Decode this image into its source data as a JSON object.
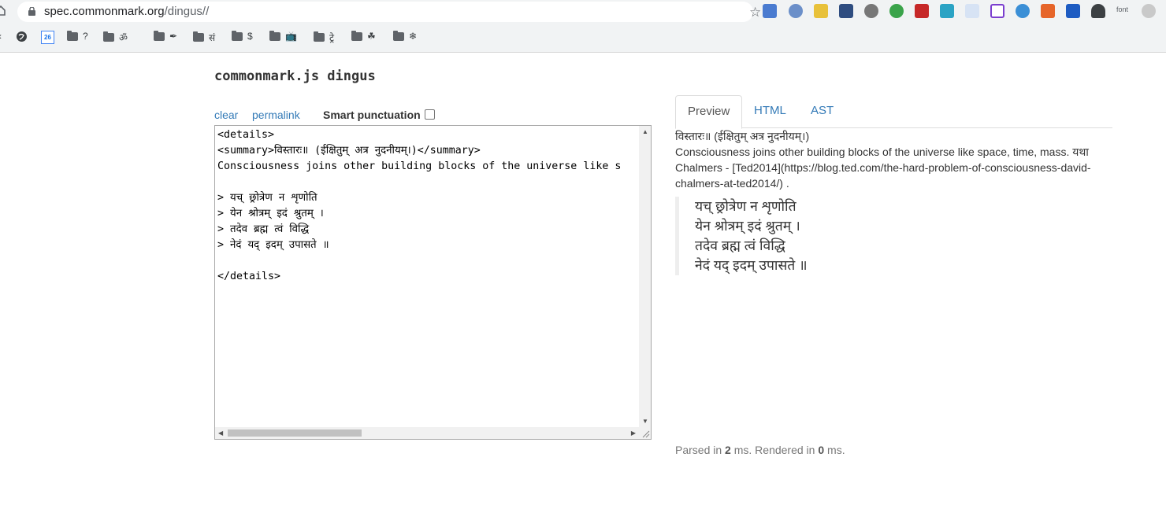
{
  "browser": {
    "url_host": "spec.commonmark.org",
    "url_path": "/dingus//",
    "extensions_font_label": "font",
    "bookmarks": [
      "?",
      "ॐ",
      "✒",
      "सं",
      "$",
      "📺",
      "ट्रे",
      "☘",
      "❄"
    ],
    "calendar_label": "26"
  },
  "page": {
    "title": "commonmark.js dingus",
    "clear_label": "clear",
    "permalink_label": "permalink",
    "smart_label": "Smart punctuation"
  },
  "editor": {
    "text": "<details>\n<summary>विस्तारः॥ (ईक्षितुम् अत्र नुदनीयम्।)</summary>\nConsciousness joins other building blocks of the universe like s\n\n> यच् छ्रोत्रेण न शृणोति\n> येन श्रोत्रम् इदं श्रुतम् ।\n> तदेव ब्रह्म त्वं विद्धि\n> नेदं यद् इदम् उपासते ॥\n\n</details>"
  },
  "tabs": {
    "preview": "Preview",
    "html": "HTML",
    "ast": "AST"
  },
  "preview": {
    "summary": "विस्तारः॥ (ईक्षितुम् अत्र नुदनीयम्।)",
    "paragraph": "Consciousness joins other building blocks of the universe like space, time, mass. यथा Chalmers - [Ted2014](https://blog.ted.com/the-hard-problem-of-consciousness-david-chalmers-at-ted2014/) .",
    "quote_lines": [
      "यच् छ्रोत्रेण न शृणोति",
      "येन श्रोत्रम् इदं श्रुतम् ।",
      "तदेव ब्रह्म त्वं विद्धि",
      "नेदं यद् इदम् उपासते ॥"
    ]
  },
  "status": {
    "parsed_prefix": "Parsed in ",
    "parsed_ms": "2",
    "rendered_prefix": " ms. Rendered in ",
    "rendered_ms": "0",
    "suffix": " ms."
  },
  "colors": {
    "link": "#337ab7",
    "text": "#333333",
    "muted": "#777777"
  }
}
